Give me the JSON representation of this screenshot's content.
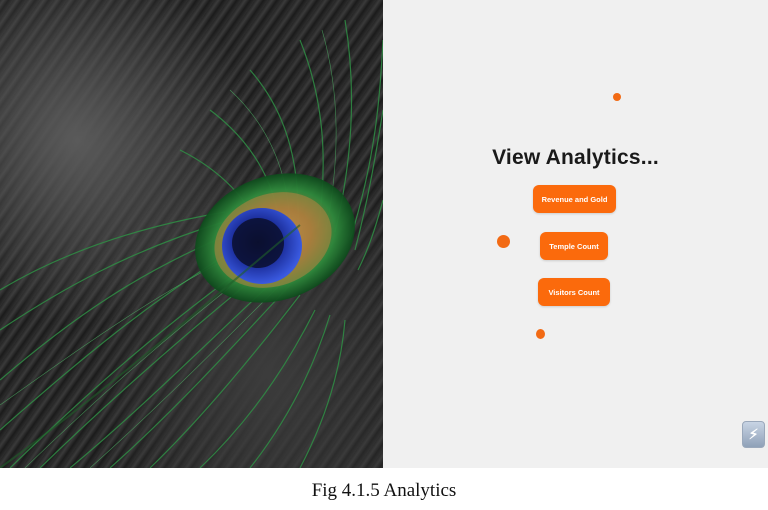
{
  "app": {
    "title": "View Analytics...",
    "buttons": [
      {
        "label": "Revenue and Gold"
      },
      {
        "label": "Temple Count"
      },
      {
        "label": "Visitors Count"
      }
    ],
    "floating_button_icon": "bolt-icon"
  },
  "image": {
    "subject": "peacock-feather-on-dark-stone"
  },
  "caption": "Fig 4.1.5 Analytics",
  "colors": {
    "accent": "#fb6a0c",
    "panel_bg": "#f0f0f0",
    "title": "#1a1a1a"
  }
}
